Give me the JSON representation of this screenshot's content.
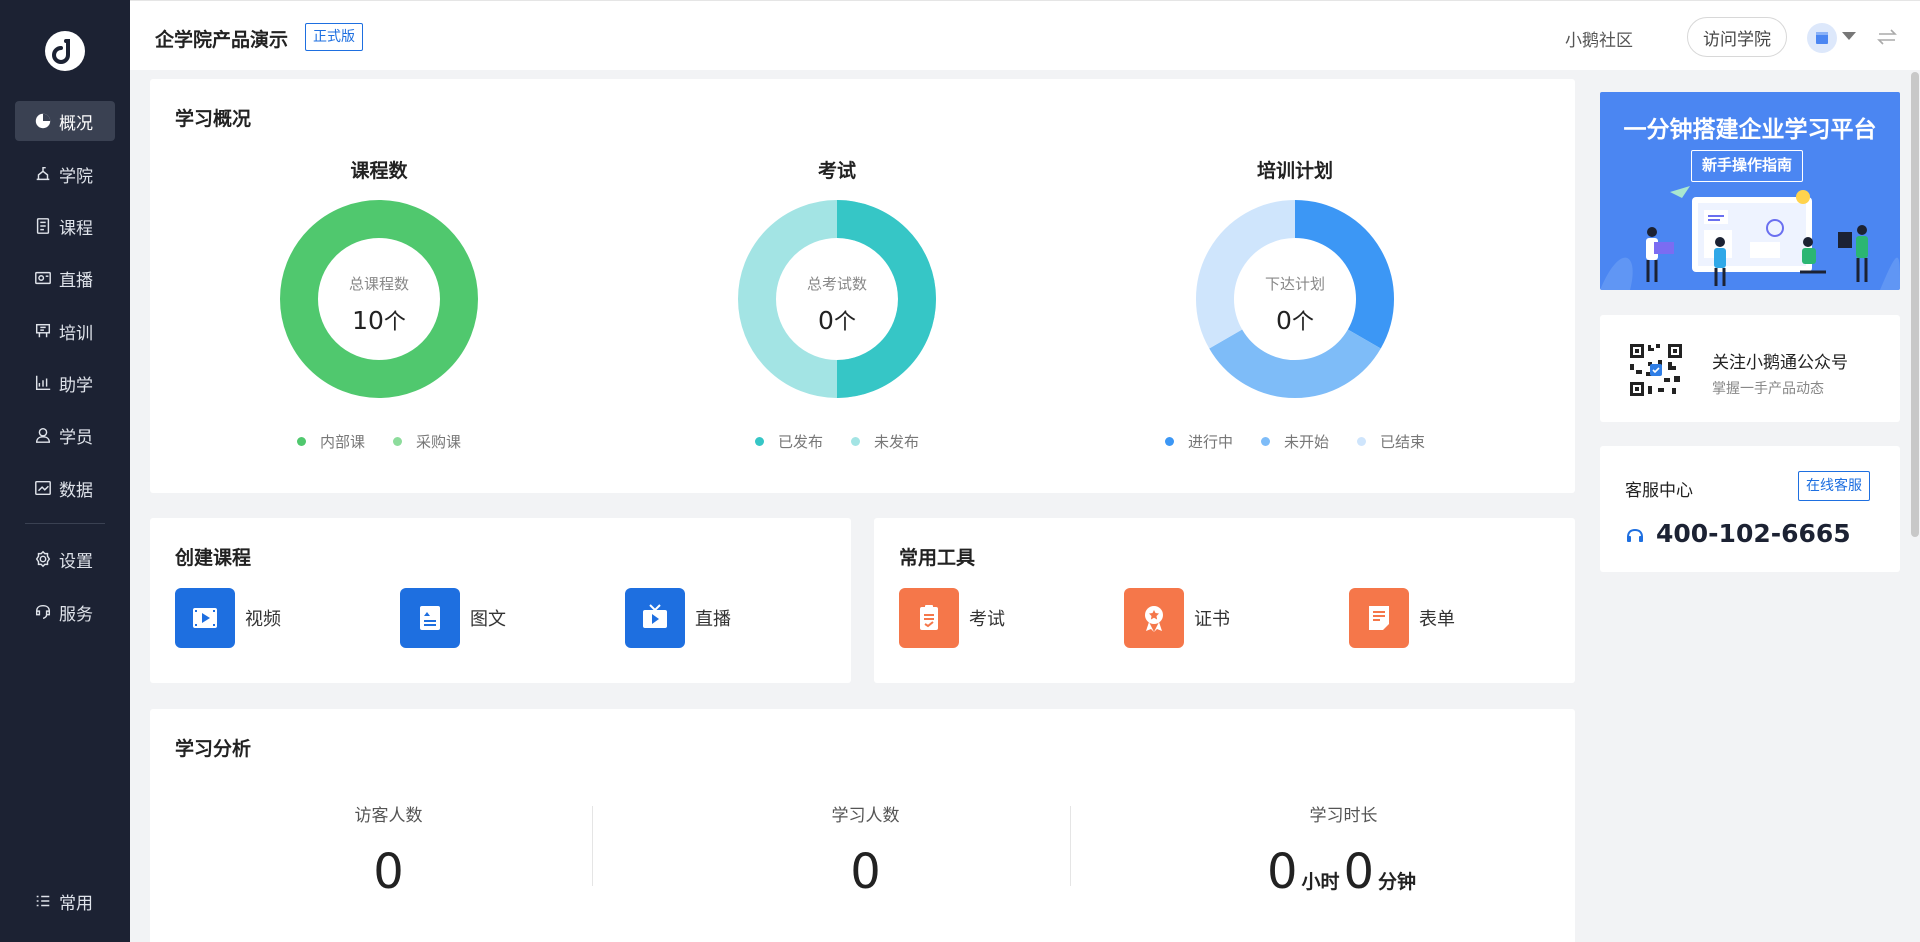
{
  "app": {
    "title": "企学院产品演示",
    "version_badge": "正式版"
  },
  "header": {
    "community": "小鹅社区",
    "visit_button": "访问学院",
    "store_icon": "store-icon",
    "switch_icon": "switch-arrows-icon"
  },
  "sidebar": {
    "items": [
      {
        "label": "概况",
        "icon": "pie-chart-icon",
        "active": true
      },
      {
        "label": "学院",
        "icon": "academy-icon"
      },
      {
        "label": "课程",
        "icon": "document-icon"
      },
      {
        "label": "直播",
        "icon": "live-icon"
      },
      {
        "label": "培训",
        "icon": "training-icon"
      },
      {
        "label": "助学",
        "icon": "chart-icon"
      },
      {
        "label": "学员",
        "icon": "user-icon"
      },
      {
        "label": "数据",
        "icon": "data-icon"
      },
      {
        "label": "设置",
        "icon": "gear-icon"
      },
      {
        "label": "服务",
        "icon": "service-icon"
      },
      {
        "label": "常用",
        "icon": "list-icon"
      }
    ]
  },
  "overview": {
    "title": "学习概况",
    "charts": [
      {
        "title": "课程数",
        "center_label": "总课程数",
        "center_value": "10",
        "unit": "个",
        "legend": [
          {
            "label": "内部课",
            "color": "#50c86e"
          },
          {
            "label": "采购课",
            "color": "#8ddc9c"
          }
        ]
      },
      {
        "title": "考试",
        "center_label": "总考试数",
        "center_value": "0",
        "unit": "个",
        "legend": [
          {
            "label": "已发布",
            "color": "#36c6c6"
          },
          {
            "label": "未发布",
            "color": "#a3e4e4"
          }
        ]
      },
      {
        "title": "培训计划",
        "center_label": "下达计划",
        "center_value": "0",
        "unit": "个",
        "legend": [
          {
            "label": "进行中",
            "color": "#3c97f5"
          },
          {
            "label": "未开始",
            "color": "#7ebcf8"
          },
          {
            "label": "已结束",
            "color": "#cfe5fc"
          }
        ]
      }
    ]
  },
  "chart_data": [
    {
      "type": "pie",
      "title": "课程数",
      "categories": [
        "内部课",
        "采购课"
      ],
      "values": [
        10,
        0
      ]
    },
    {
      "type": "pie",
      "title": "考试",
      "categories": [
        "已发布",
        "未发布"
      ],
      "values": [
        50,
        50
      ]
    },
    {
      "type": "pie",
      "title": "培训计划",
      "categories": [
        "进行中",
        "未开始",
        "已结束"
      ],
      "values": [
        33,
        33,
        34
      ]
    }
  ],
  "create_course": {
    "title": "创建课程",
    "items": [
      {
        "label": "视频",
        "icon": "video-icon",
        "color": "#1e6fe0"
      },
      {
        "label": "图文",
        "icon": "image-text-icon",
        "color": "#1e6fe0"
      },
      {
        "label": "直播",
        "icon": "live-tv-icon",
        "color": "#1e6fe0"
      }
    ]
  },
  "tools": {
    "title": "常用工具",
    "items": [
      {
        "label": "考试",
        "icon": "exam-icon",
        "color": "#f5774a"
      },
      {
        "label": "证书",
        "icon": "certificate-icon",
        "color": "#f5774a"
      },
      {
        "label": "表单",
        "icon": "form-icon",
        "color": "#f5774a"
      }
    ]
  },
  "analysis": {
    "title": "学习分析",
    "stats": [
      {
        "label": "访客人数",
        "value": "0"
      },
      {
        "label": "学习人数",
        "value": "0"
      },
      {
        "label": "学习时长",
        "hours": "0",
        "hours_unit": "小时",
        "minutes": "0",
        "minutes_unit": "分钟"
      }
    ]
  },
  "banner": {
    "title": "一分钟搭建企业学习平台",
    "button": "新手操作指南"
  },
  "wechat": {
    "title": "关注小鹅通公众号",
    "subtitle": "掌握一手产品动态"
  },
  "service": {
    "title": "客服中心",
    "button": "在线客服",
    "phone": "400-102-6665"
  }
}
